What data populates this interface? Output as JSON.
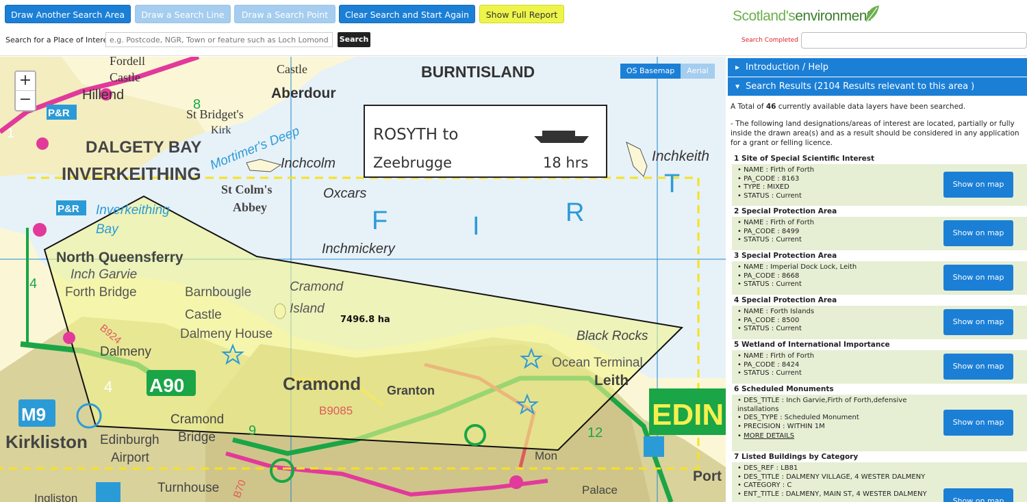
{
  "toolbar": {
    "draw_area": "Draw Another Search Area",
    "draw_line": "Draw a Search Line",
    "draw_point": "Draw a Search Point",
    "clear": "Clear Search and Start Again",
    "full_report": "Show Full Report",
    "search_label": "Search for a Place of Interest",
    "search_placeholder": "e.g. Postcode, NGR, Town or feature such as Loch Lomond",
    "search_button": "Search"
  },
  "brand": {
    "part1": "Scotland's",
    "part2": "environment"
  },
  "status": "Search Completed",
  "map": {
    "basemap_os": "OS Basemap",
    "basemap_aerial": "Aerial",
    "area_label": "7496.8 ha",
    "ferry": {
      "line1": "ROSYTH to",
      "line2": "Zeebrugge",
      "time": "18 hrs"
    },
    "places": {
      "burntisland": "BURNTISLAND",
      "aberdour": "Aberdour",
      "castle_top": "Castle",
      "fordell": "Fordell",
      "castle_left": "Castle",
      "hillend": "Hillend",
      "st_bridgets": "St Bridget's",
      "kirk": "Kirk",
      "dalgety": "DALGETY BAY",
      "inverkeithing": "INVERKEITHING",
      "mortimers": "Mortimer's Deep",
      "inchcolm": "Inchcolm",
      "inchkeith": "Inchkeith",
      "st_colms": "St Colm's",
      "abbey": "Abbey",
      "oxcars": "Oxcars",
      "inv_bay1": "Inverkeithing",
      "inv_bay2": "Bay",
      "inchmickery": "Inchmickery",
      "north_q": "North Queensferry",
      "inch_garvie": "Inch Garvie",
      "forth_bridge": "Forth Bridge",
      "barnbougle": "Barnbougle",
      "castle_b": "Castle",
      "dalmeny_house": "Dalmeny House",
      "cramond_island1": "Cramond",
      "cramond_island2": "Island",
      "b924": "B924",
      "dalmeny": "Dalmeny",
      "black_rocks": "Black Rocks",
      "ocean_terminal": "Ocean Terminal",
      "leith": "Leith",
      "cramond": "Cramond",
      "granton": "Granton",
      "b9085": "B9085",
      "a90": "A90",
      "m9": "M9",
      "kirkliston": "Kirkliston",
      "edinburgh_airport1": "Edinburgh",
      "edinburgh_airport2": "Airport",
      "cramond_bridge1": "Cramond",
      "cramond_bridge2": "Bridge",
      "turnhouse": "Turnhouse",
      "ingliston": "Ingliston",
      "edin": "EDIN",
      "port": "Port",
      "palace": "Palace",
      "mon": "Mon",
      "pr": "P&R",
      "pr2": "P&R",
      "f": "F",
      "i": "I",
      "r": "R",
      "t": "T",
      "n4": "4",
      "n4b": "4",
      "n9": "9",
      "n12": "12",
      "n8": "8",
      "n1": "1",
      "b70": "B70"
    }
  },
  "panel": {
    "intro_help": "Introduction / Help",
    "search_results": "Search Results (2104 Results relevant to this area )",
    "total_pre": "A Total of ",
    "total_num": "46",
    "total_post": " currently available data layers have been searched.",
    "note": "- The following land designations/areas of interest are located, partially or fully inside the drawn area(s) and as a result should be considered in any application for a grant or felling licence.",
    "show_on_map": "Show on map",
    "results": [
      {
        "title": "1 Site of Special Scientific Interest",
        "lines": [
          "NAME : Firth of Forth",
          "PA_CODE : 8163",
          "TYPE : MIXED",
          "STATUS : Current"
        ]
      },
      {
        "title": "2 Special Protection Area",
        "lines": [
          "NAME : Firth of Forth",
          "PA_CODE : 8499",
          "STATUS : Current"
        ]
      },
      {
        "title": "3 Special Protection Area",
        "lines": [
          "NAME : Imperial Dock Lock, Leith",
          "PA_CODE : 8668",
          "STATUS : Current"
        ]
      },
      {
        "title": "4 Special Protection Area",
        "lines": [
          "NAME : Forth Islands",
          "PA_CODE : 8500",
          "STATUS : Current"
        ]
      },
      {
        "title": "5 Wetland of International Importance",
        "lines": [
          "NAME : Firth of Forth",
          "PA_CODE : 8424",
          "STATUS : Current"
        ]
      },
      {
        "title": "6 Scheduled Monuments",
        "lines": [
          "DES_TITLE : Inch Garvie,Firth of Forth,defensive installations",
          "DES_TYPE : Scheduled Monument",
          "PRECISION : WITHIN 1M"
        ],
        "more": "MORE DETAILS"
      },
      {
        "title": "7 Listed Buildings by Category",
        "lines": [
          "DES_REF : LB81",
          "DES_TITLE : DALMENY VILLAGE, 4 WESTER DALMENY",
          "CATEGORY : C",
          "ENT_TITLE : DALMENY, MAIN ST, 4 WESTER DALMENY"
        ]
      }
    ]
  },
  "colors": {
    "accent": "#1b7fd6",
    "accent_light": "#a5cdef",
    "report": "#eef54a",
    "result_bg": "#e6efd4",
    "area_fill": "#f2f590",
    "sea": "#e7f1f8"
  }
}
